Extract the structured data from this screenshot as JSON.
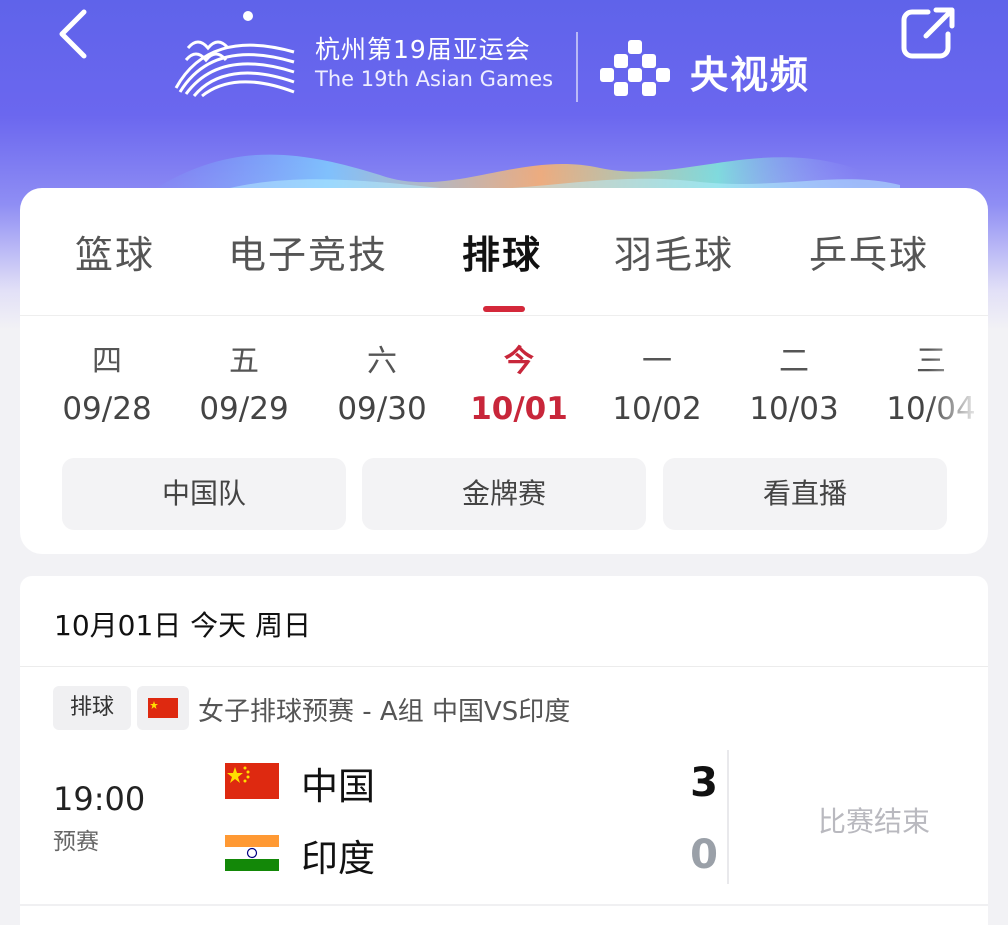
{
  "header": {
    "event_name_cn": "杭州第19届亚运会",
    "event_name_en": "The 19th Asian Games",
    "broadcaster": "央视频",
    "back_icon": "chevron-left-icon",
    "share_icon": "share-icon",
    "colors": {
      "gradient_top": "#5f63ea",
      "gradient_bottom": "#f2f2f5"
    }
  },
  "sports_tabs": [
    {
      "label": "篮球",
      "active": false
    },
    {
      "label": "电子竞技",
      "active": false
    },
    {
      "label": "排球",
      "active": true
    },
    {
      "label": "羽毛球",
      "active": false
    },
    {
      "label": "乒乓球",
      "active": false
    }
  ],
  "dates": [
    {
      "weekday": "四",
      "date": "09/28",
      "active": false
    },
    {
      "weekday": "五",
      "date": "09/29",
      "active": false
    },
    {
      "weekday": "六",
      "date": "09/30",
      "active": false
    },
    {
      "weekday": "今",
      "date": "10/01",
      "active": true
    },
    {
      "weekday": "一",
      "date": "10/02",
      "active": false
    },
    {
      "weekday": "二",
      "date": "10/03",
      "active": false
    },
    {
      "weekday": "三",
      "date": "10/04",
      "active": false
    }
  ],
  "filters": [
    "中国队",
    "金牌赛",
    "看直播"
  ],
  "schedule": {
    "date_header": "10月01日 今天 周日",
    "match": {
      "sport_tag": "排球",
      "title": "女子排球预赛 - A组 中国VS印度",
      "time": "19:00",
      "stage": "预赛",
      "status": "比赛结束",
      "teams": [
        {
          "name": "中国",
          "score": "3",
          "flag": "china-flag",
          "winner": true
        },
        {
          "name": "印度",
          "score": "0",
          "flag": "india-flag",
          "winner": false
        }
      ]
    }
  },
  "accent_color": "#d4283a"
}
